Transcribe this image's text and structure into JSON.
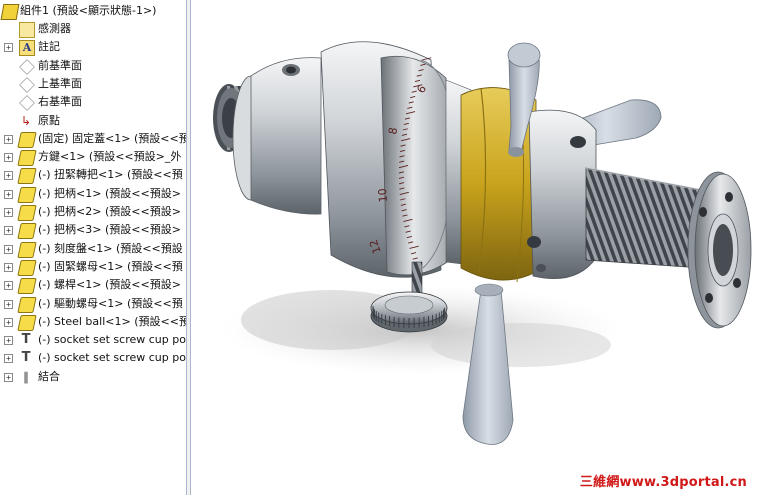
{
  "feature_tree": {
    "root_label": "組件1 (預設<顯示狀態-1>)",
    "items": [
      {
        "label": "感測器",
        "icon": "sensor-icon",
        "expandable": false
      },
      {
        "label": "註記",
        "icon": "annotation-icon",
        "expandable": true
      },
      {
        "label": "前基準面",
        "icon": "plane-icon",
        "expandable": false
      },
      {
        "label": "上基準面",
        "icon": "plane-icon",
        "expandable": false
      },
      {
        "label": "右基準面",
        "icon": "plane-icon",
        "expandable": false
      },
      {
        "label": "原點",
        "icon": "origin-icon",
        "expandable": false
      },
      {
        "label": "(固定) 固定蓋<1> (預設<<預",
        "icon": "part-icon",
        "expandable": true
      },
      {
        "label": "方鍵<1> (預設<<預設>_外",
        "icon": "part-icon",
        "expandable": true
      },
      {
        "label": "(-) 扭緊轉把<1> (預設<<預",
        "icon": "part-icon",
        "expandable": true
      },
      {
        "label": "(-) 把柄<1> (預設<<預設>",
        "icon": "part-icon",
        "expandable": true
      },
      {
        "label": "(-) 把柄<2> (預設<<預設>",
        "icon": "part-icon",
        "expandable": true
      },
      {
        "label": "(-) 把柄<3> (預設<<預設>",
        "icon": "part-icon",
        "expandable": true
      },
      {
        "label": "(-) 刻度盤<1> (預設<<預設",
        "icon": "part-icon",
        "expandable": true
      },
      {
        "label": "(-) 固緊螺母<1> (預設<<預",
        "icon": "part-icon",
        "expandable": true
      },
      {
        "label": "(-) 螺桿<1> (預設<<預設>",
        "icon": "part-icon",
        "expandable": true
      },
      {
        "label": "(-) 驅動螺母<1> (預設<<預",
        "icon": "part-icon",
        "expandable": true
      },
      {
        "label": "(-) Steel ball<1> (預設<<預",
        "icon": "part-icon",
        "expandable": true
      },
      {
        "label": "(-) socket set screw cup po",
        "icon": "screw-icon",
        "expandable": true
      },
      {
        "label": "(-) socket set screw cup po",
        "icon": "screw-icon",
        "expandable": true
      },
      {
        "label": "結合",
        "icon": "mate-icon",
        "expandable": true
      }
    ]
  },
  "dial": {
    "tick_labels": [
      "6",
      "8",
      "10",
      "12"
    ]
  },
  "watermark": "三維網www.3dportal.cn",
  "colors": {
    "brass": "#c9a31c",
    "steel": "#c8cdd2",
    "watermark": "#d01818"
  }
}
